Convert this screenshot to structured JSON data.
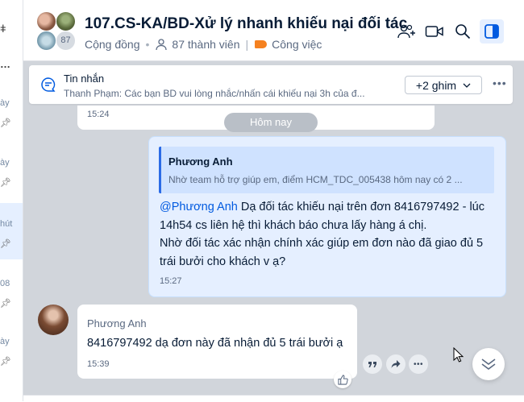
{
  "left_list": {
    "items": [
      {
        "time": "ày",
        "active": false
      },
      {
        "time": "ày",
        "active": false
      },
      {
        "time": "hút",
        "active": true
      },
      {
        "time": "08",
        "active": false
      },
      {
        "time": "ày",
        "active": false
      }
    ]
  },
  "header": {
    "title": "107.CS-KA/BD-Xử lý nhanh khiếu nại đối tác",
    "avatar_count": "87",
    "community": "Cộng đồng",
    "members": "87 thành viên",
    "category": "Công việc",
    "icons": [
      "add-member-icon",
      "video-call-icon",
      "search-icon",
      "sidebar-toggle-icon"
    ]
  },
  "pinned": {
    "label": "Tin nhắn",
    "text": "Thanh Phạm: Các bạn BD vui lòng nhắc/nhấn cái khiếu nại 3h của đ...",
    "pins_button": "+2 ghim"
  },
  "messages": {
    "prev_time": "15:24",
    "date_divider": "Hôm nay",
    "mine": {
      "quote_name": "Phương Anh",
      "quote_text": "Nhờ team hỗ trợ giúp em, điểm HCM_TDC_005438 hôm nay có 2 ...",
      "mention": "@Phương Anh",
      "body_rest": " Dạ đối tác khiếu nại trên đơn 8416797492 - lúc 14h54 cs liên hệ thì khách báo chưa lấy hàng á chị.",
      "body_line2": "Nhờ đối tác xác nhận chính xác giúp em đơn nào đã giao đủ 5 trái bưởi cho khách v ạ?",
      "time": "15:27"
    },
    "reply": {
      "sender": "Phương Anh",
      "text": "8416797492 dạ đơn này đã nhận đủ 5 trái bưởi ạ",
      "time": "15:39"
    }
  },
  "colors": {
    "accent": "#005ae0",
    "chat_bg": "#d1d5db",
    "my_bubble": "#e5efff",
    "tag": "#f5811f"
  }
}
